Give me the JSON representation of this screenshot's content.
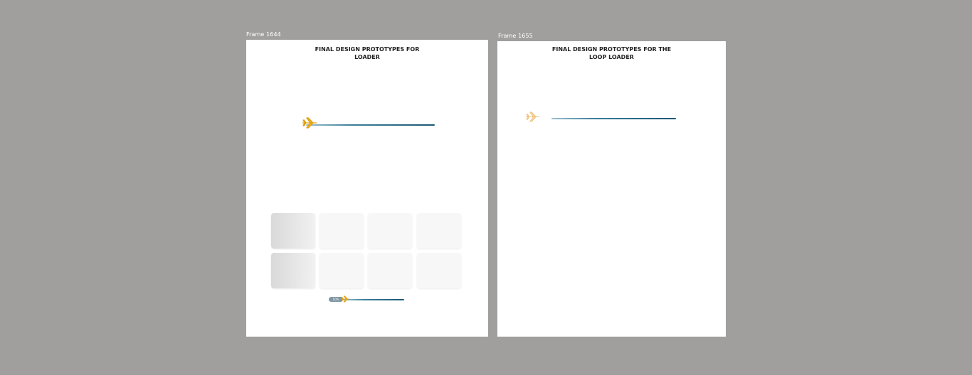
{
  "canvas": {
    "background": "#a19f9e"
  },
  "frames": [
    {
      "label": "Frame 1644",
      "title": "FINAL DESIGN PROTOTYPES FOR\nLOADER",
      "plane_color": "#f2b21a",
      "progress_badge": "10%",
      "skeleton_grid": {
        "rows": 2,
        "cols": 4
      }
    },
    {
      "label": "Frame 1655",
      "title": "FINAL DESIGN PROTOTYPES FOR  THE\nLOOP LOADER",
      "plane_color": "#f6d6a3"
    }
  ],
  "icons": {
    "plane": "airplane-icon"
  },
  "colors": {
    "track_dark": "#1c5775",
    "track_light": "#9cc1d0"
  }
}
